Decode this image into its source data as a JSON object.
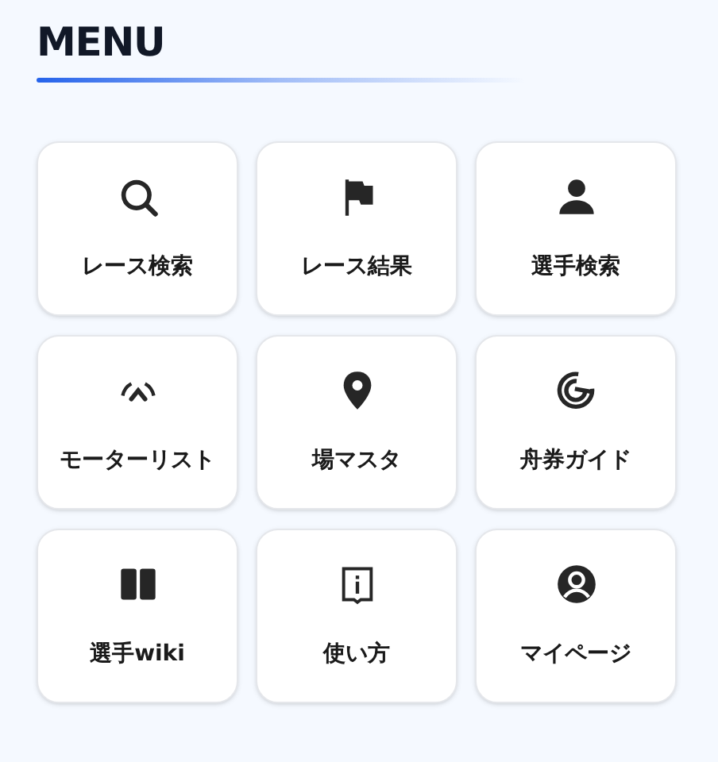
{
  "title": "MENU",
  "items": [
    {
      "label": "レース検索",
      "kind": "search"
    },
    {
      "label": "レース結果",
      "kind": "flag"
    },
    {
      "label": "選手検索",
      "kind": "person"
    },
    {
      "label": "モーターリスト",
      "kind": "gauge"
    },
    {
      "label": "場マスタ",
      "kind": "pin"
    },
    {
      "label": "舟券ガイド",
      "kind": "target"
    },
    {
      "label": "選手wiki",
      "kind": "book"
    },
    {
      "label": "使い方",
      "kind": "info"
    },
    {
      "label": "マイページ",
      "kind": "account"
    }
  ]
}
